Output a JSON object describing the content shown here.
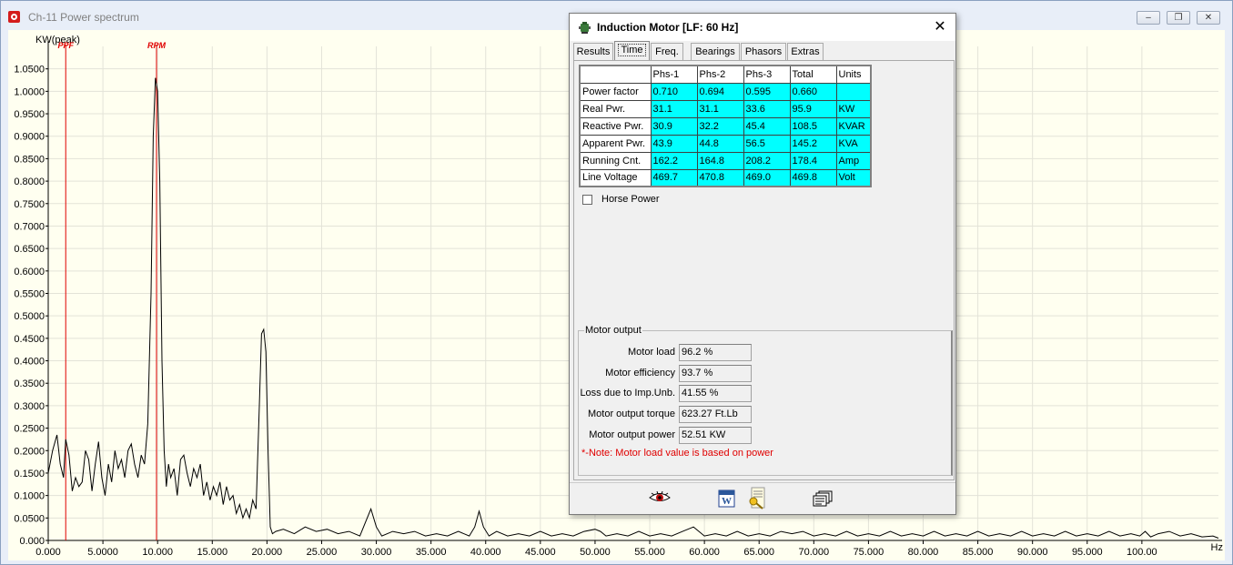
{
  "window": {
    "title": "Ch-11 Power spectrum",
    "minimize": "–",
    "restore": "❐",
    "close": "✕"
  },
  "chart_data": {
    "type": "line",
    "ylabel": "KW(peak)",
    "xlabel": "Hz",
    "xlim": [
      0,
      107
    ],
    "ylim": [
      0,
      1.1
    ],
    "grid": true,
    "x_ticks": [
      "0.000",
      "5.0000",
      "10.000",
      "15.000",
      "20.000",
      "25.000",
      "30.000",
      "35.000",
      "40.000",
      "45.000",
      "50.000",
      "55.000",
      "60.000",
      "65.000",
      "70.000",
      "75.000",
      "80.000",
      "85.000",
      "90.000",
      "95.000",
      "100.00"
    ],
    "y_ticks": [
      "0.000",
      "0.0500",
      "0.1000",
      "0.1500",
      "0.2000",
      "0.2500",
      "0.3000",
      "0.3500",
      "0.4000",
      "0.4500",
      "0.5000",
      "0.5500",
      "0.6000",
      "0.6500",
      "0.7000",
      "0.7500",
      "0.8000",
      "0.8500",
      "0.9000",
      "0.9500",
      "1.0000",
      "1.0500"
    ],
    "markers": [
      {
        "label": "PPF",
        "x": 1.6
      },
      {
        "label": "RPM",
        "x": 9.9
      }
    ],
    "series": [
      {
        "color": "#000000",
        "x": [
          0,
          0.4,
          0.8,
          1.1,
          1.4,
          1.6,
          1.9,
          2.2,
          2.5,
          2.8,
          3.1,
          3.4,
          3.7,
          4.0,
          4.3,
          4.6,
          4.9,
          5.2,
          5.5,
          5.8,
          6.1,
          6.4,
          6.7,
          7.0,
          7.3,
          7.6,
          7.9,
          8.2,
          8.5,
          8.8,
          9.1,
          9.4,
          9.6,
          9.8,
          10.0,
          10.2,
          10.4,
          10.6,
          10.8,
          11.0,
          11.2,
          11.5,
          11.8,
          12.1,
          12.4,
          12.7,
          13.0,
          13.3,
          13.6,
          13.9,
          14.2,
          14.5,
          14.8,
          15.1,
          15.4,
          15.7,
          16.0,
          16.3,
          16.6,
          16.9,
          17.2,
          17.5,
          17.8,
          18.1,
          18.4,
          18.7,
          19.0,
          19.3,
          19.5,
          19.7,
          19.9,
          20.1,
          20.3,
          20.5,
          20.8,
          21.5,
          22.5,
          23.5,
          24.5,
          25.5,
          26.5,
          27.5,
          28.5,
          29.0,
          29.5,
          30.0,
          30.5,
          31.5,
          32.5,
          33.5,
          34.5,
          35.5,
          36.5,
          37.5,
          38.5,
          39.0,
          39.4,
          39.8,
          40.3,
          41.0,
          42.0,
          43.0,
          44.0,
          45.0,
          46.0,
          47.0,
          48.0,
          49.0,
          50.0,
          50.5,
          51.0,
          52.0,
          53.0,
          54.0,
          55.0,
          56.0,
          57.0,
          58.0,
          59.0,
          59.5,
          60.0,
          61.0,
          62.0,
          63.0,
          64.0,
          65.0,
          66.0,
          67.0,
          68.0,
          69.0,
          70.0,
          71.0,
          72.0,
          73.0,
          74.0,
          75.0,
          76.0,
          77.0,
          78.0,
          79.0,
          80.0,
          81.0,
          82.0,
          83.0,
          84.0,
          85.0,
          86.0,
          87.0,
          88.0,
          89.0,
          90.0,
          91.0,
          92.0,
          93.0,
          94.0,
          95.0,
          96.0,
          97.0,
          98.0,
          99.0,
          99.8,
          100.3,
          100.8,
          101.5,
          102.5,
          103.5,
          104.5,
          105.5,
          106.5,
          107.0
        ],
        "y": [
          0.15,
          0.2,
          0.235,
          0.17,
          0.14,
          0.225,
          0.19,
          0.11,
          0.14,
          0.12,
          0.13,
          0.2,
          0.18,
          0.11,
          0.17,
          0.22,
          0.14,
          0.1,
          0.17,
          0.13,
          0.2,
          0.16,
          0.18,
          0.14,
          0.2,
          0.215,
          0.17,
          0.14,
          0.19,
          0.17,
          0.26,
          0.55,
          0.9,
          1.03,
          1.0,
          0.8,
          0.4,
          0.2,
          0.12,
          0.17,
          0.14,
          0.16,
          0.1,
          0.18,
          0.19,
          0.15,
          0.12,
          0.16,
          0.14,
          0.17,
          0.1,
          0.13,
          0.09,
          0.12,
          0.1,
          0.13,
          0.08,
          0.12,
          0.09,
          0.1,
          0.06,
          0.08,
          0.05,
          0.07,
          0.05,
          0.09,
          0.07,
          0.3,
          0.46,
          0.47,
          0.42,
          0.2,
          0.03,
          0.015,
          0.02,
          0.025,
          0.015,
          0.03,
          0.02,
          0.025,
          0.015,
          0.02,
          0.01,
          0.04,
          0.07,
          0.03,
          0.01,
          0.02,
          0.015,
          0.02,
          0.01,
          0.015,
          0.01,
          0.02,
          0.01,
          0.03,
          0.065,
          0.03,
          0.01,
          0.02,
          0.01,
          0.015,
          0.01,
          0.02,
          0.01,
          0.015,
          0.01,
          0.02,
          0.025,
          0.02,
          0.01,
          0.015,
          0.01,
          0.02,
          0.01,
          0.015,
          0.01,
          0.02,
          0.03,
          0.02,
          0.01,
          0.015,
          0.01,
          0.02,
          0.01,
          0.015,
          0.01,
          0.02,
          0.015,
          0.02,
          0.01,
          0.015,
          0.01,
          0.02,
          0.01,
          0.015,
          0.01,
          0.02,
          0.01,
          0.015,
          0.01,
          0.02,
          0.01,
          0.015,
          0.01,
          0.02,
          0.01,
          0.015,
          0.01,
          0.02,
          0.01,
          0.015,
          0.01,
          0.02,
          0.01,
          0.015,
          0.01,
          0.02,
          0.01,
          0.015,
          0.01,
          0.02,
          0.008,
          0.015,
          0.02,
          0.01,
          0.015,
          0.008,
          0.01,
          0.005
        ]
      }
    ]
  },
  "dialog": {
    "title": "Induction Motor   [LF: 60 Hz]",
    "close": "✕",
    "tabs": [
      "Results",
      "Time",
      "Freq.",
      "Bearings",
      "Phasors",
      "Extras"
    ],
    "active_tab": "Time",
    "table": {
      "headers": [
        "",
        "Phs-1",
        "Phs-2",
        "Phs-3",
        "Total",
        "Units"
      ],
      "rows": [
        [
          "Power factor",
          "0.710",
          "0.694",
          "0.595",
          "0.660",
          ""
        ],
        [
          "Real Pwr.",
          "31.1",
          "31.1",
          "33.6",
          "95.9",
          "KW"
        ],
        [
          "Reactive Pwr.",
          "30.9",
          "32.2",
          "45.4",
          "108.5",
          "KVAR"
        ],
        [
          "Apparent Pwr.",
          "43.9",
          "44.8",
          "56.5",
          "145.2",
          "KVA"
        ],
        [
          "Running Cnt.",
          "162.2",
          "164.8",
          "208.2",
          "178.4",
          "Amp"
        ],
        [
          "Line Voltage",
          "469.7",
          "470.8",
          "469.0",
          "469.8",
          "Volt"
        ]
      ]
    },
    "horse_power_label": "Horse Power",
    "motor_output": {
      "legend": "Motor output",
      "fields": [
        {
          "label": "Motor load",
          "value": "96.2 %"
        },
        {
          "label": "Motor efficiency",
          "value": "93.7 %"
        },
        {
          "label": "Loss due to Imp.Unb.",
          "value": "41.55 %"
        },
        {
          "label": "Motor output torque",
          "value": "623.27 Ft.Lb"
        },
        {
          "label": "Motor output power",
          "value": "52.51 KW"
        }
      ],
      "note": "*-Note: Motor load value is based on power"
    }
  }
}
